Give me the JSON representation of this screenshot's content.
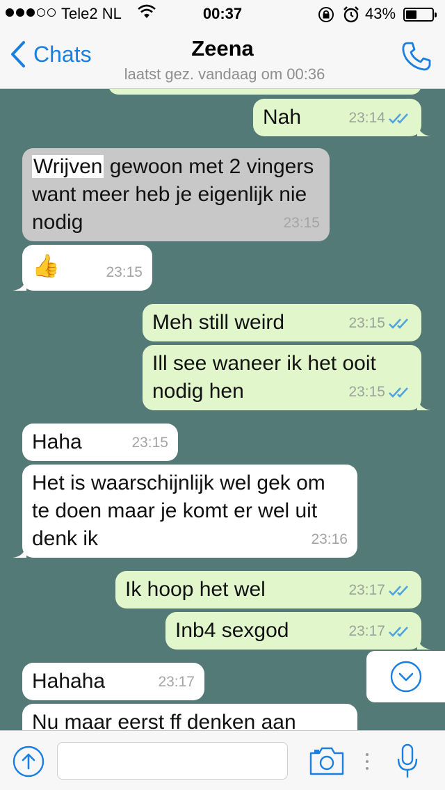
{
  "status_bar": {
    "carrier": "Tele2 NL",
    "time": "00:37",
    "battery_percent": "43%",
    "battery_level": 0.43,
    "signal_bars_filled": 3,
    "signal_bars_total": 5
  },
  "header": {
    "back_label": "Chats",
    "contact_name": "Zeena",
    "last_seen": "laatst gez. vandaag om 00:36",
    "accent_color": "#1a7fe0"
  },
  "messages": [
    {
      "dir": "out",
      "text": "Nah",
      "time": "23:14",
      "read": true
    },
    {
      "dir": "in",
      "highlight": "Wrijven",
      "text": " gewoon met 2 vingers want meer heb je eigenlijk nie nodig",
      "time": "23:15",
      "selected": true
    },
    {
      "dir": "in",
      "emoji": "👍",
      "time": "23:15"
    },
    {
      "dir": "out",
      "text": "Meh still weird",
      "time": "23:15",
      "read": true
    },
    {
      "dir": "out",
      "text": "Ill see waneer ik het ooit nodig hen",
      "time": "23:15",
      "read": true
    },
    {
      "dir": "in",
      "text": "Haha",
      "time": "23:15"
    },
    {
      "dir": "in",
      "text": "Het is waarschijnlijk wel gek om te doen maar je komt er wel uit denk ik",
      "time": "23:16"
    },
    {
      "dir": "out",
      "text": "Ik hoop het wel",
      "time": "23:17",
      "read": true
    },
    {
      "dir": "out",
      "text": "Inb4 sexgod",
      "time": "23:17",
      "read": true
    },
    {
      "dir": "in",
      "text": "Hahaha",
      "time": "23:17"
    },
    {
      "dir": "in",
      "text": "Nu maar eerst ff denken aan",
      "time": ""
    }
  ],
  "input_bar": {
    "message_placeholder": ""
  },
  "colors": {
    "chat_background": "#547a78",
    "outgoing_bubble": "#e1f7cb",
    "incoming_bubble": "#ffffff",
    "read_ticks": "#4fa3e0"
  }
}
